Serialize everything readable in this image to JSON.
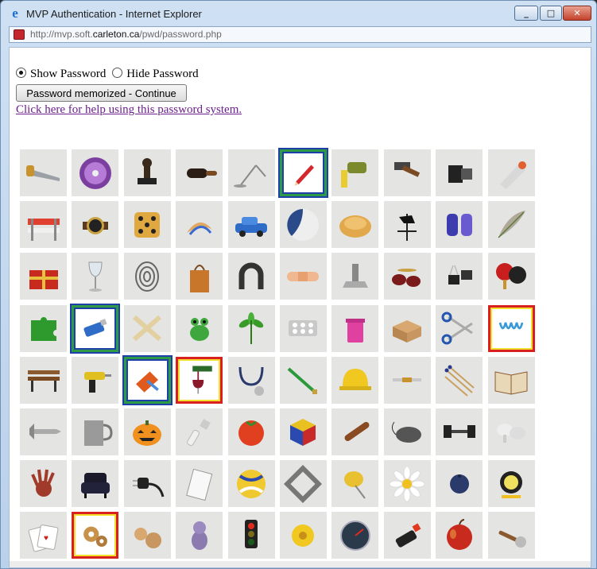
{
  "window": {
    "title": "MVP Authentication - Internet Explorer",
    "controls": {
      "minimize": "_",
      "maximize": "□",
      "close": "✕"
    }
  },
  "address": {
    "prefix": "http://mvp.soft.",
    "domain": "carleton.ca",
    "suffix": "/pwd/password.php"
  },
  "options": {
    "show_password": "Show Password",
    "hide_password": "Hide Password",
    "selected": "show"
  },
  "continue_label": "Password memorized - Continue",
  "help_link": "Click here for help using this password system.",
  "colors": {
    "selection_blue": "#1c3fa8",
    "selection_green": "#2f9a45",
    "selection_red": "#d82020",
    "selection_yellow": "#f2e02a",
    "link": "#6b1f8a"
  },
  "grid": [
    {
      "icon": "handsaw-icon"
    },
    {
      "icon": "cd-disc-icon"
    },
    {
      "icon": "rubber-stamp-icon"
    },
    {
      "icon": "hairbrush-icon"
    },
    {
      "icon": "desk-lamp-icon"
    },
    {
      "icon": "pencil-icon",
      "selected": "blue"
    },
    {
      "icon": "pouring-bottle-icon"
    },
    {
      "icon": "hammer-icon"
    },
    {
      "icon": "film-roll-icon"
    },
    {
      "icon": "paint-tube-icon"
    },
    {
      "icon": "road-barrier-icon"
    },
    {
      "icon": "wristwatch-icon"
    },
    {
      "icon": "dice-icon"
    },
    {
      "icon": "pencil-shavings-icon"
    },
    {
      "icon": "blue-car-icon"
    },
    {
      "icon": "ball-icon"
    },
    {
      "icon": "bread-roll-icon"
    },
    {
      "icon": "weathervane-icon"
    },
    {
      "icon": "gloves-icon"
    },
    {
      "icon": "feather-icon"
    },
    {
      "icon": "gift-box-icon"
    },
    {
      "icon": "wine-glass-icon"
    },
    {
      "icon": "fingerprint-icon"
    },
    {
      "icon": "paper-bag-icon"
    },
    {
      "icon": "horseshoe-icon"
    },
    {
      "icon": "bandage-icon"
    },
    {
      "icon": "bolt-nut-icon"
    },
    {
      "icon": "drum-kit-icon"
    },
    {
      "icon": "binder-clips-icon"
    },
    {
      "icon": "ping-pong-paddles-icon"
    },
    {
      "icon": "puzzle-piece-icon"
    },
    {
      "icon": "usb-drive-icon",
      "selected": "blue"
    },
    {
      "icon": "crossed-bones-icon"
    },
    {
      "icon": "frog-figurine-icon"
    },
    {
      "icon": "green-leaves-icon"
    },
    {
      "icon": "pill-blister-icon"
    },
    {
      "icon": "pink-trash-can-icon"
    },
    {
      "icon": "cardboard-box-icon"
    },
    {
      "icon": "scissors-icon"
    },
    {
      "icon": "spring-coil-icon",
      "selected": "red"
    },
    {
      "icon": "park-bench-icon"
    },
    {
      "icon": "power-drill-icon"
    },
    {
      "icon": "dustpan-brush-icon",
      "selected": "blue"
    },
    {
      "icon": "wine-pour-icon",
      "selected": "red"
    },
    {
      "icon": "stethoscope-icon"
    },
    {
      "icon": "green-brush-icon"
    },
    {
      "icon": "hard-hat-icon"
    },
    {
      "icon": "thermometer-icon"
    },
    {
      "icon": "matches-icon"
    },
    {
      "icon": "open-book-icon"
    },
    {
      "icon": "screw-icon"
    },
    {
      "icon": "metal-mug-icon"
    },
    {
      "icon": "jack-o-lantern-icon"
    },
    {
      "icon": "cfl-bulb-icon"
    },
    {
      "icon": "tomato-icon"
    },
    {
      "icon": "rubiks-cube-icon"
    },
    {
      "icon": "cigar-icon"
    },
    {
      "icon": "computer-mouse-icon"
    },
    {
      "icon": "dumbbell-icon"
    },
    {
      "icon": "mushrooms-icon"
    },
    {
      "icon": "handprint-icon"
    },
    {
      "icon": "armchair-icon"
    },
    {
      "icon": "power-plug-icon"
    },
    {
      "icon": "notepad-icon"
    },
    {
      "icon": "volleyball-icon"
    },
    {
      "icon": "picture-frame-icon"
    },
    {
      "icon": "push-pin-icon"
    },
    {
      "icon": "daisy-icon"
    },
    {
      "icon": "blueberry-icon"
    },
    {
      "icon": "work-light-icon"
    },
    {
      "icon": "playing-cards-icon"
    },
    {
      "icon": "gears-icon",
      "selected": "red"
    },
    {
      "icon": "wooden-toy-icon"
    },
    {
      "icon": "plush-toy-icon"
    },
    {
      "icon": "traffic-light-icon"
    },
    {
      "icon": "yellow-flower-icon"
    },
    {
      "icon": "speedometer-icon"
    },
    {
      "icon": "lighter-icon"
    },
    {
      "icon": "apple-icon"
    },
    {
      "icon": "ice-cream-scoop-icon"
    }
  ]
}
